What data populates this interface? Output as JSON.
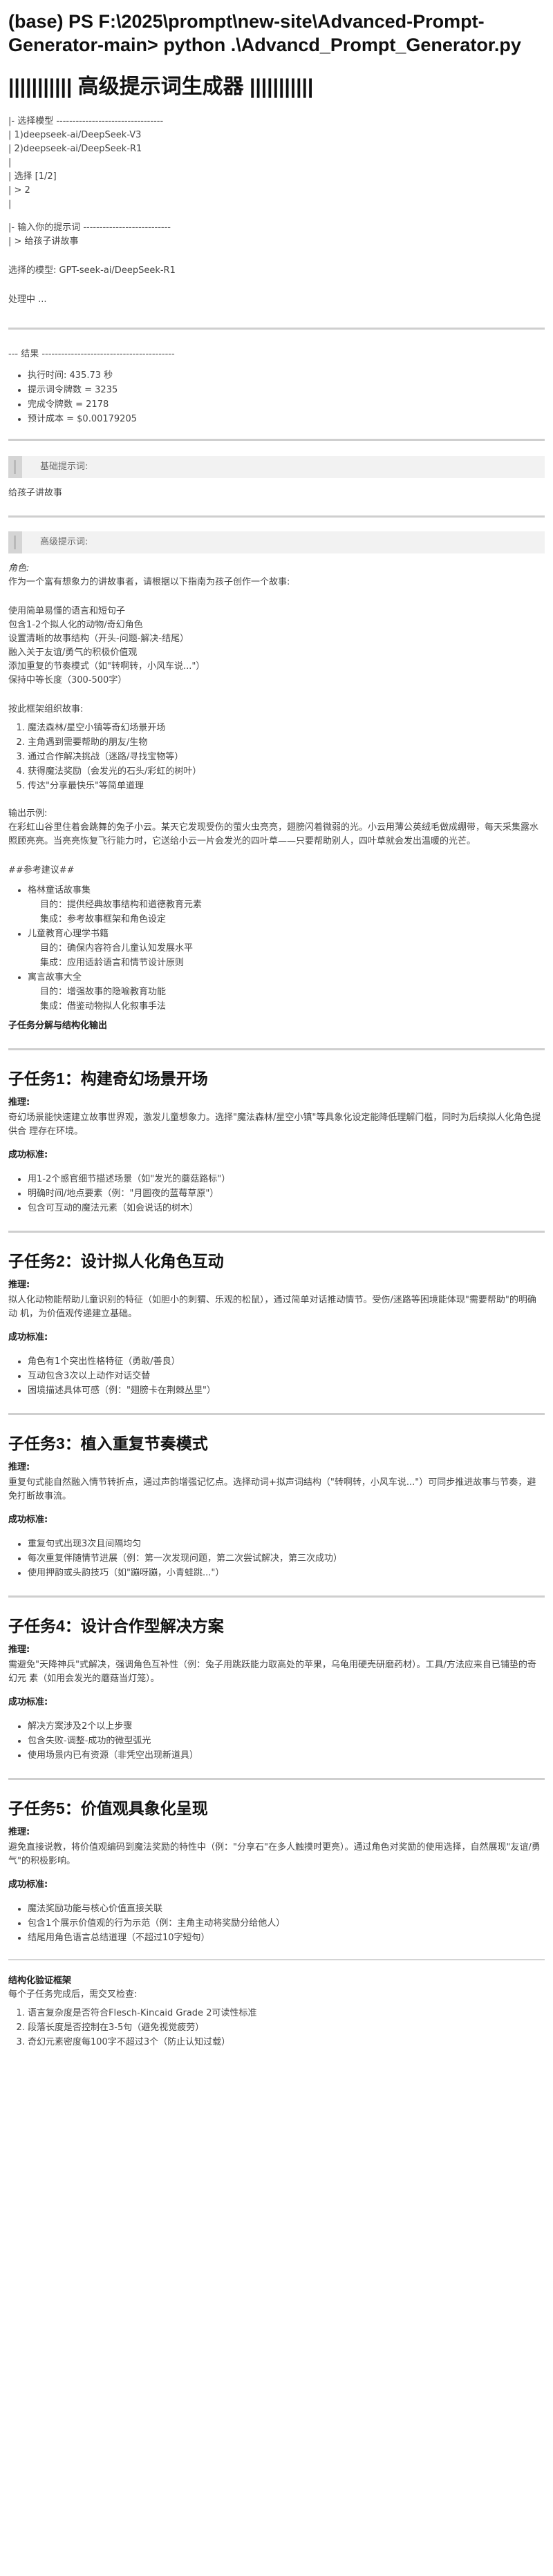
{
  "terminal": {
    "command": "(base) PS F:\\2025\\prompt\\new-site\\Advanced-Prompt-Generator-main> python .\\Advancd_Prompt_Generator.py"
  },
  "app": {
    "title": "||||||||||| 高级提示词生成器 |||||||||||"
  },
  "model_select": {
    "lines": [
      "|- 选择模型 ---------------------------------",
      "| 1)deepseek-ai/DeepSeek-V3",
      "| 2)deepseek-ai/DeepSeek-R1",
      "|",
      "| 选择 [1/2]",
      "| > 2",
      "|"
    ],
    "input_lines": [
      "|- 输入你的提示词 ---------------------------",
      "| > 给孩子讲故事"
    ],
    "selected": "选择的模型: GPT-seek-ai/DeepSeek-R1",
    "processing": "处理中 ..."
  },
  "results": {
    "header": "--- 结果 -----------------------------------------",
    "metrics": [
      "执行时间: 435.73 秒",
      "提示词令牌数 = 3235",
      "完成令牌数 = 2178",
      "预计成本 = $0.00179205"
    ]
  },
  "basic": {
    "label": "基础提示词:",
    "text": "给孩子讲故事"
  },
  "advanced": {
    "label": "高级提示词:",
    "role_heading": "角色:",
    "role_text": "作为一个富有想象力的讲故事者，请根据以下指南为孩子创作一个故事:",
    "guidelines": [
      "使用简单易懂的语言和短句子",
      "包含1-2个拟人化的动物/奇幻角色",
      "设置清晰的故事结构（开头-问题-解决-结尾）",
      "融入关于友谊/勇气的积极价值观",
      "添加重复的节奏模式（如\"转啊转，小风车说...\"）",
      "保持中等长度（300-500字）"
    ],
    "framework_heading": "按此框架组织故事:",
    "framework": [
      "魔法森林/星空小镇等奇幻场景开场",
      "主角遇到需要帮助的朋友/生物",
      "通过合作解决挑战（迷路/寻找宝物等）",
      "获得魔法奖励（会发光的石头/彩虹的树叶）",
      "传达\"分享最快乐\"等简单道理"
    ],
    "example_heading": "输出示例:",
    "example_text": "在彩虹山谷里住着会跳舞的兔子小云。某天它发现受伤的萤火虫亮亮，翅膀闪着微弱的光。小云用薄公英绒毛做成绷带，每天采集露水照顾亮亮。当亮亮恢复飞行能力时，它送给小云一片会发光的四叶草——只要帮助别人，四叶草就会发出温暖的光芒。",
    "ref_heading": "##参考建议##",
    "refs": [
      {
        "name": "格林童话故事集",
        "goal": "目的：提供经典故事结构和道德教育元素",
        "use": "集成：参考故事框架和角色设定"
      },
      {
        "name": "儿童教育心理学书籍",
        "goal": "目的：确保内容符合儿童认知发展水平",
        "use": "集成：应用适龄语言和情节设计原则"
      },
      {
        "name": "寓言故事大全",
        "goal": "目的：增强故事的隐喻教育功能",
        "use": "集成：借鉴动物拟人化叙事手法"
      }
    ],
    "subtask_heading": "子任务分解与结构化输出"
  },
  "subtasks": [
    {
      "title": "子任务1：构建奇幻场景开场",
      "reason_label": "推理:",
      "reason": "奇幻场景能快速建立故事世界观，激发儿童想象力。选择\"魔法森林/星空小镇\"等具象化设定能降低理解门槛，同时为后续拟人化角色提供合 理存在环境。",
      "criteria_label": "成功标准:",
      "criteria": [
        "用1-2个感官细节描述场景（如\"发光的蘑菇路标\"）",
        "明确时间/地点要素（例：\"月圆夜的蓝莓草原\"）",
        "包含可互动的魔法元素（如会说话的树木）"
      ]
    },
    {
      "title": "子任务2：设计拟人化角色互动",
      "reason_label": "推理:",
      "reason": "拟人化动物能帮助儿童识别的特征（如胆小的刺猬、乐观的松鼠），通过简单对话推动情节。受伤/迷路等困境能体现\"需要帮助\"的明确动 机，为价值观传递建立基础。",
      "criteria_label": "成功标准:",
      "criteria": [
        "角色有1个突出性格特征（勇敢/善良）",
        "互动包含3次以上动作对话交替",
        "困境描述具体可感（例：\"翅膀卡在荆棘丛里\"）"
      ]
    },
    {
      "title": "子任务3：植入重复节奏模式",
      "reason_label": "推理:",
      "reason": "重复句式能自然融入情节转折点，通过声韵增强记忆点。选择动词+拟声词结构（\"转啊转，小风车说...\"）可同步推进故事与节奏，避免打断故事流。",
      "criteria_label": "成功标准:",
      "criteria": [
        "重复句式出现3次且间隔均匀",
        "每次重复伴随情节进展（例：第一次发现问题，第二次尝试解决，第三次成功）",
        "使用押韵或头韵技巧（如\"蹦呀蹦，小青蛙跳...\"）"
      ]
    },
    {
      "title": "子任务4：设计合作型解决方案",
      "reason_label": "推理:",
      "reason": "需避免\"天降神兵\"式解决，强调角色互补性（例：兔子用跳跃能力取高处的苹果，乌龟用硬壳研磨药材）。工具/方法应来自已铺垫的奇幻元 素（如用会发光的蘑菇当灯笼）。",
      "criteria_label": "成功标准:",
      "criteria": [
        "解决方案涉及2个以上步骤",
        "包含失败-调整-成功的微型弧光",
        "使用场景内已有资源（非凭空出现新道具）"
      ]
    },
    {
      "title": "子任务5：价值观具象化呈现",
      "reason_label": "推理:",
      "reason": "避免直接说教，将价值观编码到魔法奖励的特性中（例：\"分享石\"在多人触摸时更亮）。通过角色对奖励的使用选择，自然展现\"友谊/勇气\"的积极影响。",
      "criteria_label": "成功标准:",
      "criteria": [
        "魔法奖励功能与核心价值直接关联",
        "包含1个展示价值观的行为示范（例：主角主动将奖励分给他人）",
        "结尾用角色语言总结道理（不超过10字短句）"
      ]
    }
  ],
  "validation": {
    "heading": "结构化验证框架",
    "intro": "每个子任务完成后，需交叉检查:",
    "items": [
      "语言复杂度是否符合Flesch-Kincaid Grade 2可读性标准",
      "段落长度是否控制在3-5句（避免视觉疲劳）",
      "奇幻元素密度每100字不超过3个（防止认知过载）"
    ]
  }
}
